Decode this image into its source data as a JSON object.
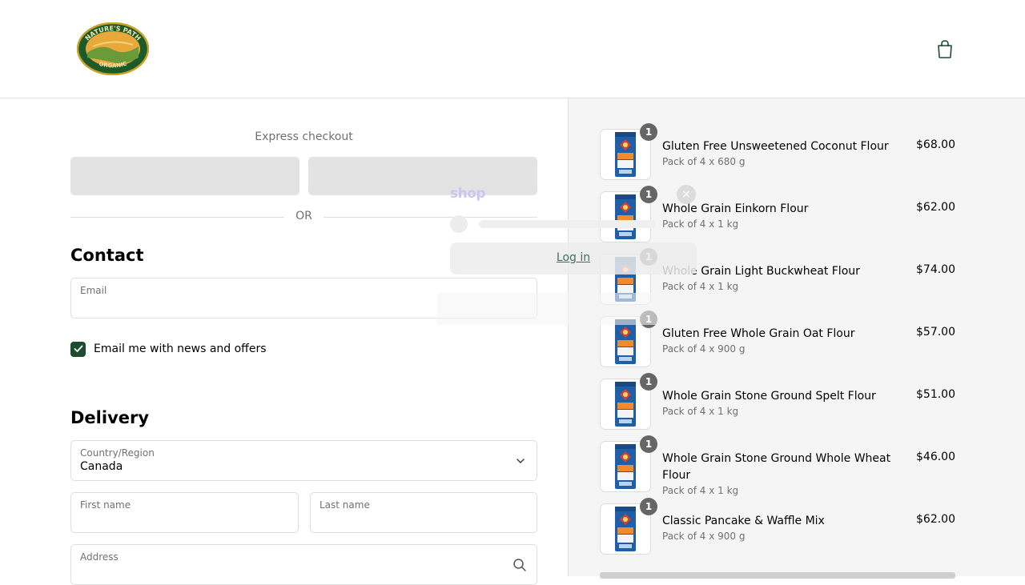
{
  "header": {
    "logo_top_text": "NATURE'S PATH",
    "logo_bottom_text": "ORGANIC"
  },
  "express": {
    "title": "Express checkout",
    "or_label": "OR"
  },
  "shop_popup": {
    "logo_text": "shop",
    "close_glyph": "×",
    "login_label": "Log in"
  },
  "contact": {
    "title": "Contact",
    "email_label": "Email",
    "email_value": "",
    "news_label": "Email me with news and offers",
    "news_checked": true
  },
  "delivery": {
    "title": "Delivery",
    "country_label": "Country/Region",
    "country_value": "Canada",
    "first_name_label": "First name",
    "last_name_label": "Last name",
    "address_label": "Address"
  },
  "cart": {
    "items": [
      {
        "name": "Gluten Free Unsweetened Coconut Flour",
        "variant": "Pack of 4 x 680 g",
        "price": "$68.00",
        "qty": "1"
      },
      {
        "name": "Whole Grain Einkorn Flour",
        "variant": "Pack of 4 x 1 kg",
        "price": "$62.00",
        "qty": "1"
      },
      {
        "name": "Whole Grain Light Buckwheat Flour",
        "variant": "Pack of 4 x 1 kg",
        "price": "$74.00",
        "qty": "1"
      },
      {
        "name": "Gluten Free Whole Grain Oat Flour",
        "variant": "Pack of 4 x 900 g",
        "price": "$57.00",
        "qty": "1"
      },
      {
        "name": "Whole Grain Stone Ground Spelt Flour",
        "variant": "Pack of 4 x 1 kg",
        "price": "$51.00",
        "qty": "1"
      },
      {
        "name": "Whole Grain Stone Ground Whole Wheat Flour",
        "variant": "Pack of 4 x 1 kg",
        "price": "$46.00",
        "qty": "1"
      },
      {
        "name": "Classic Pancake & Waffle Mix",
        "variant": "Pack of 4 x 900 g",
        "price": "$62.00",
        "qty": "1"
      }
    ]
  },
  "colors": {
    "brand_green": "#1b4d2e",
    "muted_text": "#707070",
    "summary_bg": "#f5f5f5"
  }
}
